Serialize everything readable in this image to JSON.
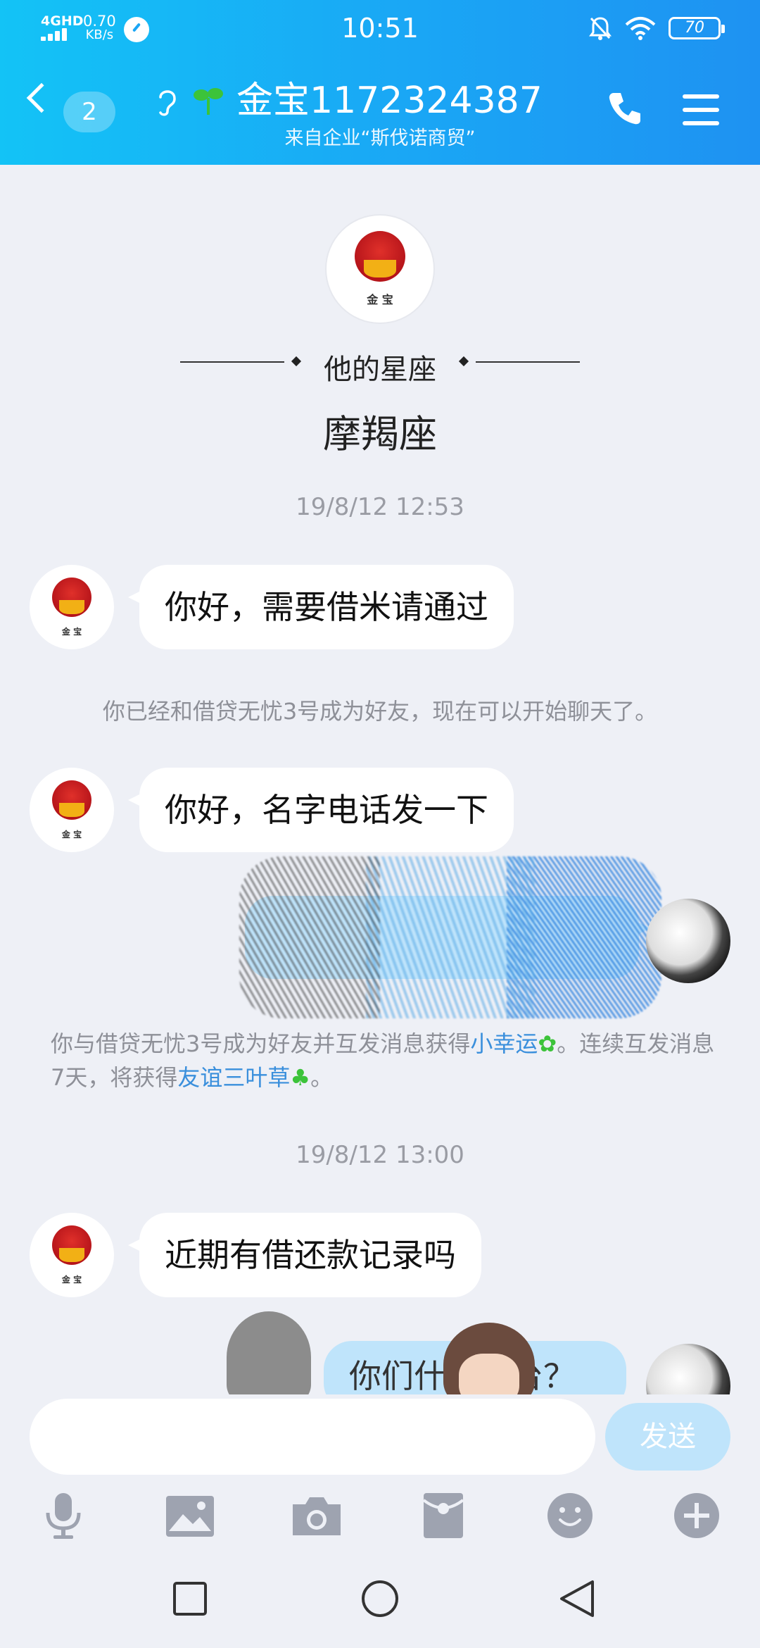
{
  "status_bar": {
    "network": "4GHD",
    "speed_value": "0.70",
    "speed_unit": "KB/s",
    "time": "10:51",
    "battery": "70"
  },
  "header": {
    "unread_count": "2",
    "contact_name": "金宝1172324387",
    "subtitle": "来自企业“斯伐诺商贸”"
  },
  "profile": {
    "avatar_caption": "金 宝",
    "zodiac_label": "他的星座",
    "zodiac_value": "摩羯座"
  },
  "messages": {
    "timestamp_1": "19/8/12 12:53",
    "msg_1": "你好，需要借米请通过",
    "system_1": "你已经和借贷无忧3号成为好友，现在可以开始聊天了。",
    "msg_2": "你好，名字电话发一下",
    "system_2_prefix": "你与借贷无忧3号成为好友并互发消息获得",
    "system_2_link_1": "小幸运",
    "system_2_middle": "。连续互发消息7天，将获得",
    "system_2_link_2": "友谊三叶草",
    "system_2_suffix": "。",
    "timestamp_2": "19/8/12 13:00",
    "msg_3": "近期有借还款记录吗",
    "msg_4_partial": "你们什么平台？"
  },
  "input": {
    "placeholder": "",
    "send_label": "发送"
  },
  "toolbar": [
    "microphone-icon",
    "image-icon",
    "camera-icon",
    "red-packet-icon",
    "emoji-icon",
    "plus-icon"
  ],
  "colors": {
    "header_start": "#13c3f6",
    "header_end": "#1e92f2",
    "link": "#3a8fdc",
    "my_bubble": "#bfe4fb"
  }
}
